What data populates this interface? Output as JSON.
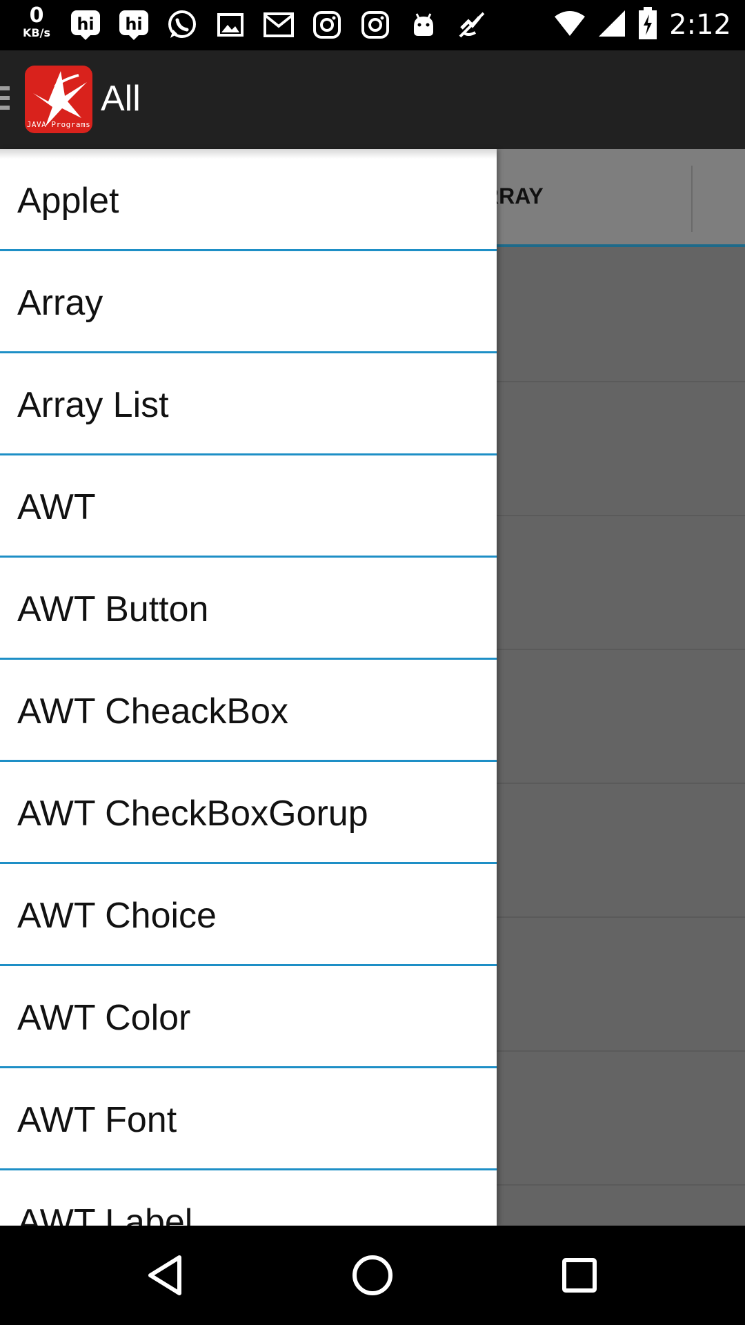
{
  "status_bar": {
    "net_speed_value": "0",
    "net_speed_unit": "KB/s",
    "time": "2:12",
    "icons": [
      "hi-notification-icon",
      "hi-notification-icon",
      "whatsapp-icon",
      "gallery-icon",
      "gmail-icon",
      "instagram-icon",
      "instagram-icon",
      "android-icon",
      "muted-icon",
      "wifi-icon",
      "signal-icon",
      "battery-charging-icon"
    ]
  },
  "app_bar": {
    "title": "All",
    "logo_text": "JAVA Programs",
    "logo_color": "#d9221c"
  },
  "tabs": {
    "visible_label": "RRAY"
  },
  "drawer": {
    "items": [
      "Applet",
      "Array",
      "Array List",
      "AWT",
      "AWT Button",
      "AWT CheackBox",
      "AWT CheckBoxGorup",
      "AWT Choice",
      "AWT Color",
      "AWT Font",
      "AWT Label"
    ],
    "divider_color": "#1e8fc6"
  },
  "nav_bar": {
    "icons": [
      "back-icon",
      "home-icon",
      "recents-icon"
    ]
  }
}
